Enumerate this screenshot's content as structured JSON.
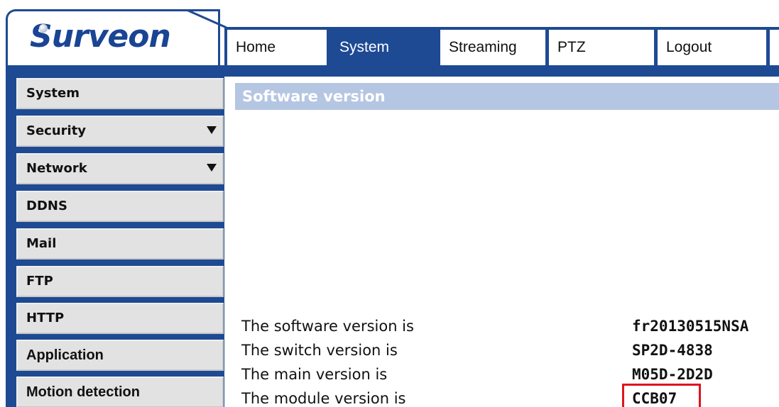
{
  "brand": {
    "logo_text": "Surveon"
  },
  "nav": {
    "tabs": [
      {
        "label": "Home",
        "active": false
      },
      {
        "label": "System",
        "active": true
      },
      {
        "label": "Streaming",
        "active": false
      },
      {
        "label": "PTZ",
        "active": false
      },
      {
        "label": "Logout",
        "active": false
      }
    ]
  },
  "sidebar": {
    "items": [
      {
        "label": "System",
        "has_submenu": false
      },
      {
        "label": "Security",
        "has_submenu": true
      },
      {
        "label": "Network",
        "has_submenu": true
      },
      {
        "label": "DDNS",
        "has_submenu": false
      },
      {
        "label": "Mail",
        "has_submenu": false
      },
      {
        "label": "FTP",
        "has_submenu": false
      },
      {
        "label": "HTTP",
        "has_submenu": false
      },
      {
        "label": "Application",
        "has_submenu": false
      },
      {
        "label": "Motion detection",
        "has_submenu": false
      }
    ]
  },
  "main": {
    "section_title": "Software version",
    "versions": [
      {
        "label": "The software version is",
        "value": "fr20130515NSA"
      },
      {
        "label": "The switch version is",
        "value": "SP2D-4838"
      },
      {
        "label": "The main version is",
        "value": "M05D-2D2D"
      },
      {
        "label": "The module version is",
        "value": "CCB07",
        "highlighted": true
      }
    ]
  },
  "colors": {
    "brand_blue": "#1e4a93",
    "section_header_bg": "#b5c6e3",
    "highlight_red": "#e0141e",
    "sidebar_item_bg": "#e2e2e2"
  },
  "icons": {
    "submenu_indicator": "caret-down-icon"
  }
}
